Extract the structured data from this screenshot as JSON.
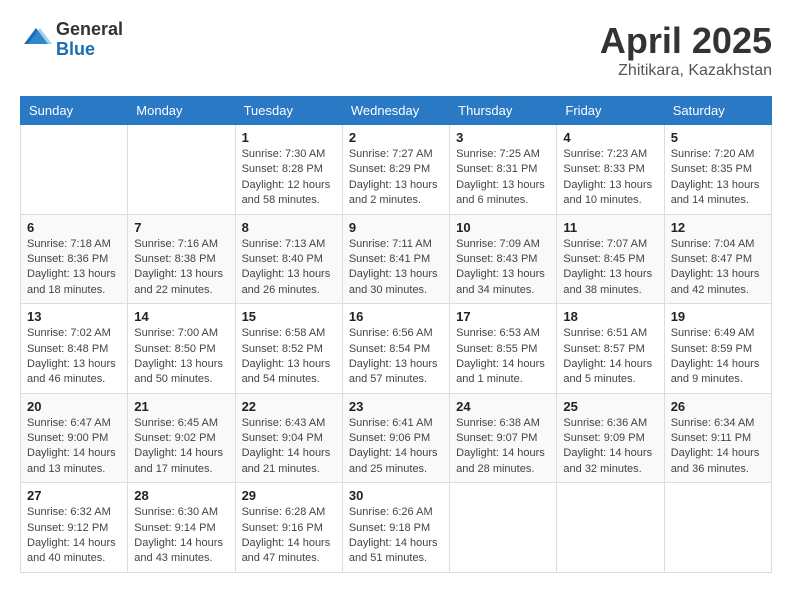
{
  "header": {
    "logo_general": "General",
    "logo_blue": "Blue",
    "month_title": "April 2025",
    "location": "Zhitikara, Kazakhstan"
  },
  "calendar": {
    "days_of_week": [
      "Sunday",
      "Monday",
      "Tuesday",
      "Wednesday",
      "Thursday",
      "Friday",
      "Saturday"
    ],
    "weeks": [
      [
        {
          "day": "",
          "info": ""
        },
        {
          "day": "",
          "info": ""
        },
        {
          "day": "1",
          "info": "Sunrise: 7:30 AM\nSunset: 8:28 PM\nDaylight: 12 hours and 58 minutes."
        },
        {
          "day": "2",
          "info": "Sunrise: 7:27 AM\nSunset: 8:29 PM\nDaylight: 13 hours and 2 minutes."
        },
        {
          "day": "3",
          "info": "Sunrise: 7:25 AM\nSunset: 8:31 PM\nDaylight: 13 hours and 6 minutes."
        },
        {
          "day": "4",
          "info": "Sunrise: 7:23 AM\nSunset: 8:33 PM\nDaylight: 13 hours and 10 minutes."
        },
        {
          "day": "5",
          "info": "Sunrise: 7:20 AM\nSunset: 8:35 PM\nDaylight: 13 hours and 14 minutes."
        }
      ],
      [
        {
          "day": "6",
          "info": "Sunrise: 7:18 AM\nSunset: 8:36 PM\nDaylight: 13 hours and 18 minutes."
        },
        {
          "day": "7",
          "info": "Sunrise: 7:16 AM\nSunset: 8:38 PM\nDaylight: 13 hours and 22 minutes."
        },
        {
          "day": "8",
          "info": "Sunrise: 7:13 AM\nSunset: 8:40 PM\nDaylight: 13 hours and 26 minutes."
        },
        {
          "day": "9",
          "info": "Sunrise: 7:11 AM\nSunset: 8:41 PM\nDaylight: 13 hours and 30 minutes."
        },
        {
          "day": "10",
          "info": "Sunrise: 7:09 AM\nSunset: 8:43 PM\nDaylight: 13 hours and 34 minutes."
        },
        {
          "day": "11",
          "info": "Sunrise: 7:07 AM\nSunset: 8:45 PM\nDaylight: 13 hours and 38 minutes."
        },
        {
          "day": "12",
          "info": "Sunrise: 7:04 AM\nSunset: 8:47 PM\nDaylight: 13 hours and 42 minutes."
        }
      ],
      [
        {
          "day": "13",
          "info": "Sunrise: 7:02 AM\nSunset: 8:48 PM\nDaylight: 13 hours and 46 minutes."
        },
        {
          "day": "14",
          "info": "Sunrise: 7:00 AM\nSunset: 8:50 PM\nDaylight: 13 hours and 50 minutes."
        },
        {
          "day": "15",
          "info": "Sunrise: 6:58 AM\nSunset: 8:52 PM\nDaylight: 13 hours and 54 minutes."
        },
        {
          "day": "16",
          "info": "Sunrise: 6:56 AM\nSunset: 8:54 PM\nDaylight: 13 hours and 57 minutes."
        },
        {
          "day": "17",
          "info": "Sunrise: 6:53 AM\nSunset: 8:55 PM\nDaylight: 14 hours and 1 minute."
        },
        {
          "day": "18",
          "info": "Sunrise: 6:51 AM\nSunset: 8:57 PM\nDaylight: 14 hours and 5 minutes."
        },
        {
          "day": "19",
          "info": "Sunrise: 6:49 AM\nSunset: 8:59 PM\nDaylight: 14 hours and 9 minutes."
        }
      ],
      [
        {
          "day": "20",
          "info": "Sunrise: 6:47 AM\nSunset: 9:00 PM\nDaylight: 14 hours and 13 minutes."
        },
        {
          "day": "21",
          "info": "Sunrise: 6:45 AM\nSunset: 9:02 PM\nDaylight: 14 hours and 17 minutes."
        },
        {
          "day": "22",
          "info": "Sunrise: 6:43 AM\nSunset: 9:04 PM\nDaylight: 14 hours and 21 minutes."
        },
        {
          "day": "23",
          "info": "Sunrise: 6:41 AM\nSunset: 9:06 PM\nDaylight: 14 hours and 25 minutes."
        },
        {
          "day": "24",
          "info": "Sunrise: 6:38 AM\nSunset: 9:07 PM\nDaylight: 14 hours and 28 minutes."
        },
        {
          "day": "25",
          "info": "Sunrise: 6:36 AM\nSunset: 9:09 PM\nDaylight: 14 hours and 32 minutes."
        },
        {
          "day": "26",
          "info": "Sunrise: 6:34 AM\nSunset: 9:11 PM\nDaylight: 14 hours and 36 minutes."
        }
      ],
      [
        {
          "day": "27",
          "info": "Sunrise: 6:32 AM\nSunset: 9:12 PM\nDaylight: 14 hours and 40 minutes."
        },
        {
          "day": "28",
          "info": "Sunrise: 6:30 AM\nSunset: 9:14 PM\nDaylight: 14 hours and 43 minutes."
        },
        {
          "day": "29",
          "info": "Sunrise: 6:28 AM\nSunset: 9:16 PM\nDaylight: 14 hours and 47 minutes."
        },
        {
          "day": "30",
          "info": "Sunrise: 6:26 AM\nSunset: 9:18 PM\nDaylight: 14 hours and 51 minutes."
        },
        {
          "day": "",
          "info": ""
        },
        {
          "day": "",
          "info": ""
        },
        {
          "day": "",
          "info": ""
        }
      ]
    ]
  }
}
